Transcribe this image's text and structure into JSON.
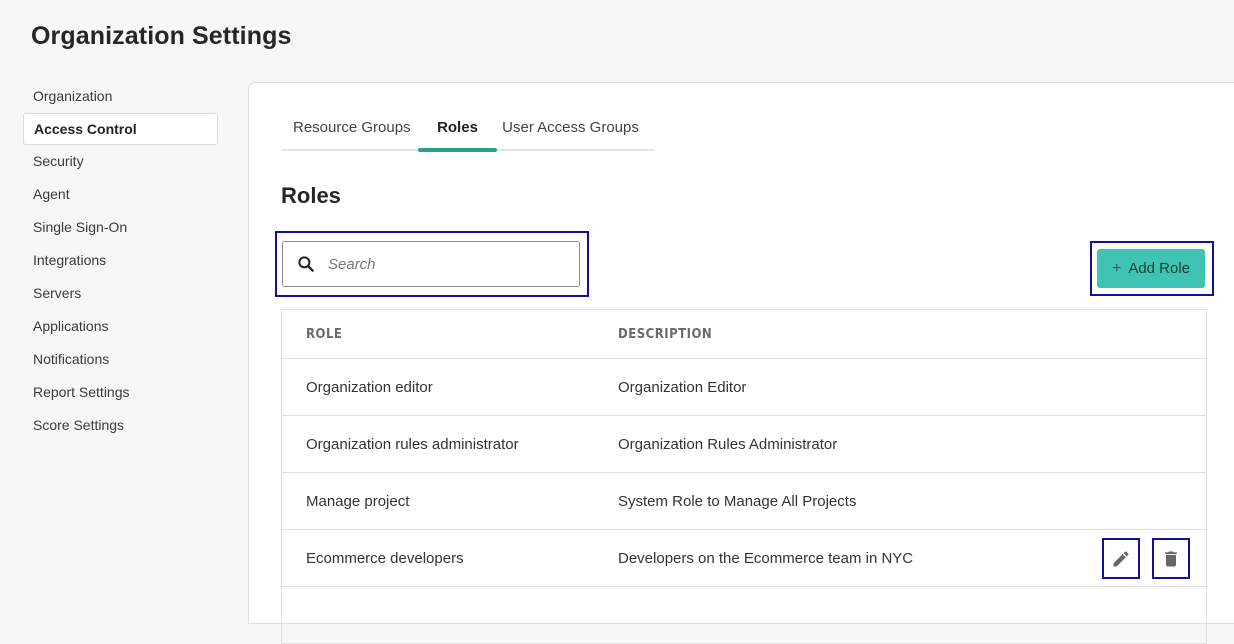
{
  "page": {
    "title": "Organization Settings"
  },
  "sidebar": {
    "items": [
      {
        "label": "Organization",
        "active": false
      },
      {
        "label": "Access Control",
        "active": true
      },
      {
        "label": "Security",
        "active": false
      },
      {
        "label": "Agent",
        "active": false
      },
      {
        "label": "Single Sign-On",
        "active": false
      },
      {
        "label": "Integrations",
        "active": false
      },
      {
        "label": "Servers",
        "active": false
      },
      {
        "label": "Applications",
        "active": false
      },
      {
        "label": "Notifications",
        "active": false
      },
      {
        "label": "Report Settings",
        "active": false
      },
      {
        "label": "Score Settings",
        "active": false
      }
    ]
  },
  "tabs": [
    {
      "label": "Resource Groups",
      "active": false
    },
    {
      "label": "Roles",
      "active": true
    },
    {
      "label": "User Access Groups",
      "active": false
    }
  ],
  "section": {
    "title": "Roles"
  },
  "search": {
    "placeholder": "Search",
    "value": ""
  },
  "toolbar": {
    "add_label": "Add Role",
    "add_icon": "plus-icon"
  },
  "table": {
    "headers": {
      "role": "ROLE",
      "description": "DESCRIPTION"
    },
    "rows": [
      {
        "role": "Organization editor",
        "description": "Organization Editor",
        "show_actions": false
      },
      {
        "role": "Organization rules administrator",
        "description": "Organization Rules Administrator",
        "show_actions": false
      },
      {
        "role": "Manage project",
        "description": "System Role to Manage All Projects",
        "show_actions": false
      },
      {
        "role": "Ecommerce developers",
        "description": "Developers on the Ecommerce team in NYC",
        "show_actions": true
      }
    ],
    "row_actions": {
      "edit_icon": "pencil-icon",
      "delete_icon": "trash-icon"
    }
  },
  "colors": {
    "accent": "#3fc3b2",
    "tab_indicator": "#2f9e8a",
    "highlight_border": "#1010a0"
  }
}
